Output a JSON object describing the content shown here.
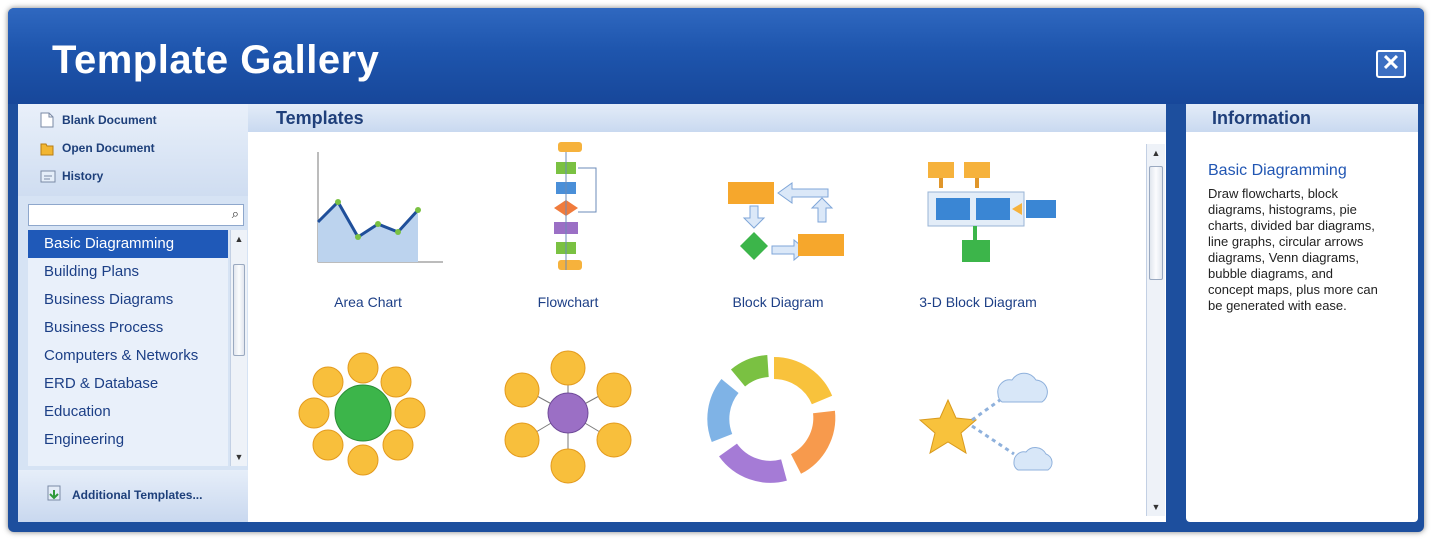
{
  "window": {
    "title": "Template Gallery",
    "close_label": "✕"
  },
  "quick_actions": [
    {
      "label": "Blank Document",
      "icon": "blank-document-icon"
    },
    {
      "label": "Open Document",
      "icon": "open-folder-icon"
    },
    {
      "label": "History",
      "icon": "history-icon"
    }
  ],
  "search": {
    "value": "",
    "placeholder": "",
    "icon": "search-icon"
  },
  "categories": {
    "selected": "Basic Diagramming",
    "items": [
      "Basic Diagramming",
      "Building Plans",
      "Business Diagrams",
      "Business Process",
      "Computers & Networks",
      "ERD & Database",
      "Education",
      "Engineering"
    ]
  },
  "additional_templates": {
    "label": "Additional Templates...",
    "icon": "download-icon"
  },
  "templates": {
    "header": "Templates",
    "items": [
      {
        "label": "Area Chart",
        "icon": "area-chart-icon"
      },
      {
        "label": "Flowchart",
        "icon": "flowchart-icon"
      },
      {
        "label": "Block Diagram",
        "icon": "block-diagram-icon"
      },
      {
        "label": "3-D Block Diagram",
        "icon": "3d-block-diagram-icon"
      },
      {
        "label": "",
        "icon": "green-hub-diagram-icon"
      },
      {
        "label": "",
        "icon": "purple-hub-diagram-icon"
      },
      {
        "label": "",
        "icon": "circular-arrows-icon"
      },
      {
        "label": "",
        "icon": "star-cloud-icon"
      }
    ]
  },
  "information": {
    "header": "Information",
    "title": "Basic Diagramming",
    "body": "Draw flowcharts, block diagrams, histograms, pie charts, divided bar diagrams, line graphs, circular arrows diagrams, Venn diagrams, bubble diagrams, and concept maps, plus more can be generated with ease."
  },
  "colors": {
    "titlebar": "#1e55ad",
    "selection": "#1f59b8",
    "link_text": "#1d3f86"
  }
}
